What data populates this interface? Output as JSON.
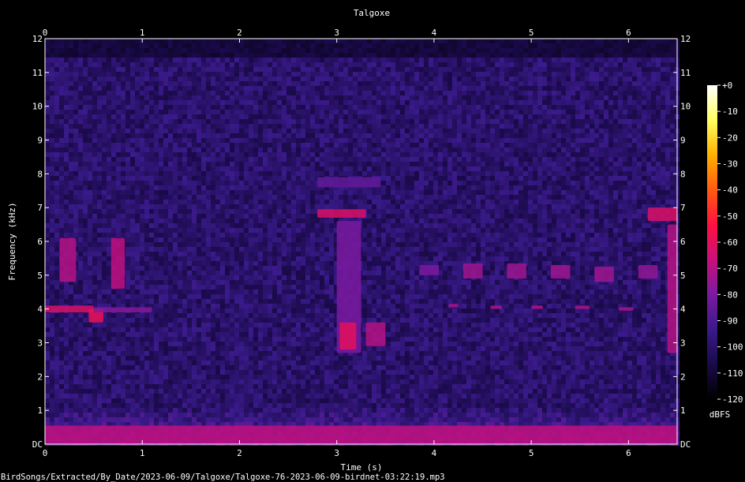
{
  "chart_data": {
    "type": "heatmap",
    "title": "Talgoxe",
    "xlabel": "Time (s)",
    "ylabel": "Frequency (kHz)",
    "xlim": [
      0,
      6.5
    ],
    "ylim": [
      0,
      12
    ],
    "x_ticks": [
      "0",
      "1",
      "2",
      "3",
      "4",
      "5",
      "6"
    ],
    "y_ticks": [
      "DC",
      "1",
      "2",
      "3",
      "4",
      "5",
      "6",
      "7",
      "8",
      "9",
      "10",
      "11",
      "12"
    ],
    "colorbar": {
      "label": "dBFS",
      "ticks": [
        "+0",
        "-10",
        "-20",
        "-30",
        "-40",
        "-50",
        "-60",
        "-70",
        "-80",
        "-90",
        "-100",
        "-110",
        "-120"
      ],
      "range": [
        -120,
        0
      ],
      "colors": [
        "#000000",
        "#1a0a4a",
        "#3a1a8a",
        "#7a1aa0",
        "#c8107a",
        "#ff1040",
        "#ff5a10",
        "#ffb000",
        "#ffff60",
        "#ffffff"
      ]
    },
    "background_level_db": -100,
    "upper_cutoff_khz": 11.5,
    "events": [
      {
        "t_start": 0.0,
        "t_end": 0.5,
        "f_low": 3.9,
        "f_high": 4.1,
        "level_db": -62
      },
      {
        "t_start": 0.15,
        "t_end": 0.32,
        "f_low": 4.8,
        "f_high": 6.1,
        "level_db": -70
      },
      {
        "t_start": 0.45,
        "t_end": 0.6,
        "f_low": 3.6,
        "f_high": 4.0,
        "level_db": -58
      },
      {
        "t_start": 0.68,
        "t_end": 0.82,
        "f_low": 4.6,
        "f_high": 6.1,
        "level_db": -68
      },
      {
        "t_start": 0.5,
        "t_end": 1.1,
        "f_low": 3.9,
        "f_high": 4.05,
        "level_db": -78
      },
      {
        "t_start": 2.8,
        "t_end": 3.3,
        "f_low": 6.7,
        "f_high": 6.95,
        "level_db": -62
      },
      {
        "t_start": 3.0,
        "t_end": 3.25,
        "f_low": 2.7,
        "f_high": 6.6,
        "level_db": -80
      },
      {
        "t_start": 3.03,
        "t_end": 3.2,
        "f_low": 2.8,
        "f_high": 3.6,
        "level_db": -60
      },
      {
        "t_start": 3.3,
        "t_end": 3.5,
        "f_low": 2.9,
        "f_high": 3.6,
        "level_db": -70
      },
      {
        "t_start": 2.8,
        "t_end": 3.45,
        "f_low": 7.6,
        "f_high": 7.9,
        "level_db": -85
      },
      {
        "t_start": 3.85,
        "t_end": 4.05,
        "f_low": 5.0,
        "f_high": 5.3,
        "level_db": -80
      },
      {
        "t_start": 4.15,
        "t_end": 4.25,
        "f_low": 4.05,
        "f_high": 4.15,
        "level_db": -72
      },
      {
        "t_start": 4.3,
        "t_end": 4.5,
        "f_low": 4.9,
        "f_high": 5.35,
        "level_db": -74
      },
      {
        "t_start": 4.58,
        "t_end": 4.7,
        "f_low": 4.0,
        "f_high": 4.1,
        "level_db": -72
      },
      {
        "t_start": 4.75,
        "t_end": 4.95,
        "f_low": 4.9,
        "f_high": 5.35,
        "level_db": -74
      },
      {
        "t_start": 5.0,
        "t_end": 5.12,
        "f_low": 4.0,
        "f_high": 4.1,
        "level_db": -72
      },
      {
        "t_start": 5.2,
        "t_end": 5.4,
        "f_low": 4.9,
        "f_high": 5.3,
        "level_db": -74
      },
      {
        "t_start": 5.45,
        "t_end": 5.6,
        "f_low": 4.0,
        "f_high": 4.1,
        "level_db": -72
      },
      {
        "t_start": 5.65,
        "t_end": 5.85,
        "f_low": 4.8,
        "f_high": 5.25,
        "level_db": -74
      },
      {
        "t_start": 5.9,
        "t_end": 6.05,
        "f_low": 3.95,
        "f_high": 4.05,
        "level_db": -72
      },
      {
        "t_start": 6.1,
        "t_end": 6.3,
        "f_low": 4.9,
        "f_high": 5.3,
        "level_db": -76
      },
      {
        "t_start": 6.2,
        "t_end": 6.5,
        "f_low": 6.6,
        "f_high": 7.0,
        "level_db": -62
      },
      {
        "t_start": 6.4,
        "t_end": 6.5,
        "f_low": 2.7,
        "f_high": 6.5,
        "level_db": -70
      },
      {
        "t_start": 0.0,
        "t_end": 6.5,
        "f_low": 0.0,
        "f_high": 0.55,
        "level_db": -68
      }
    ]
  },
  "footer": {
    "file_path": "BirdSongs/Extracted/By_Date/2023-06-09/Talgoxe/Talgoxe-76-2023-06-09-birdnet-03:22:19.mp3"
  }
}
